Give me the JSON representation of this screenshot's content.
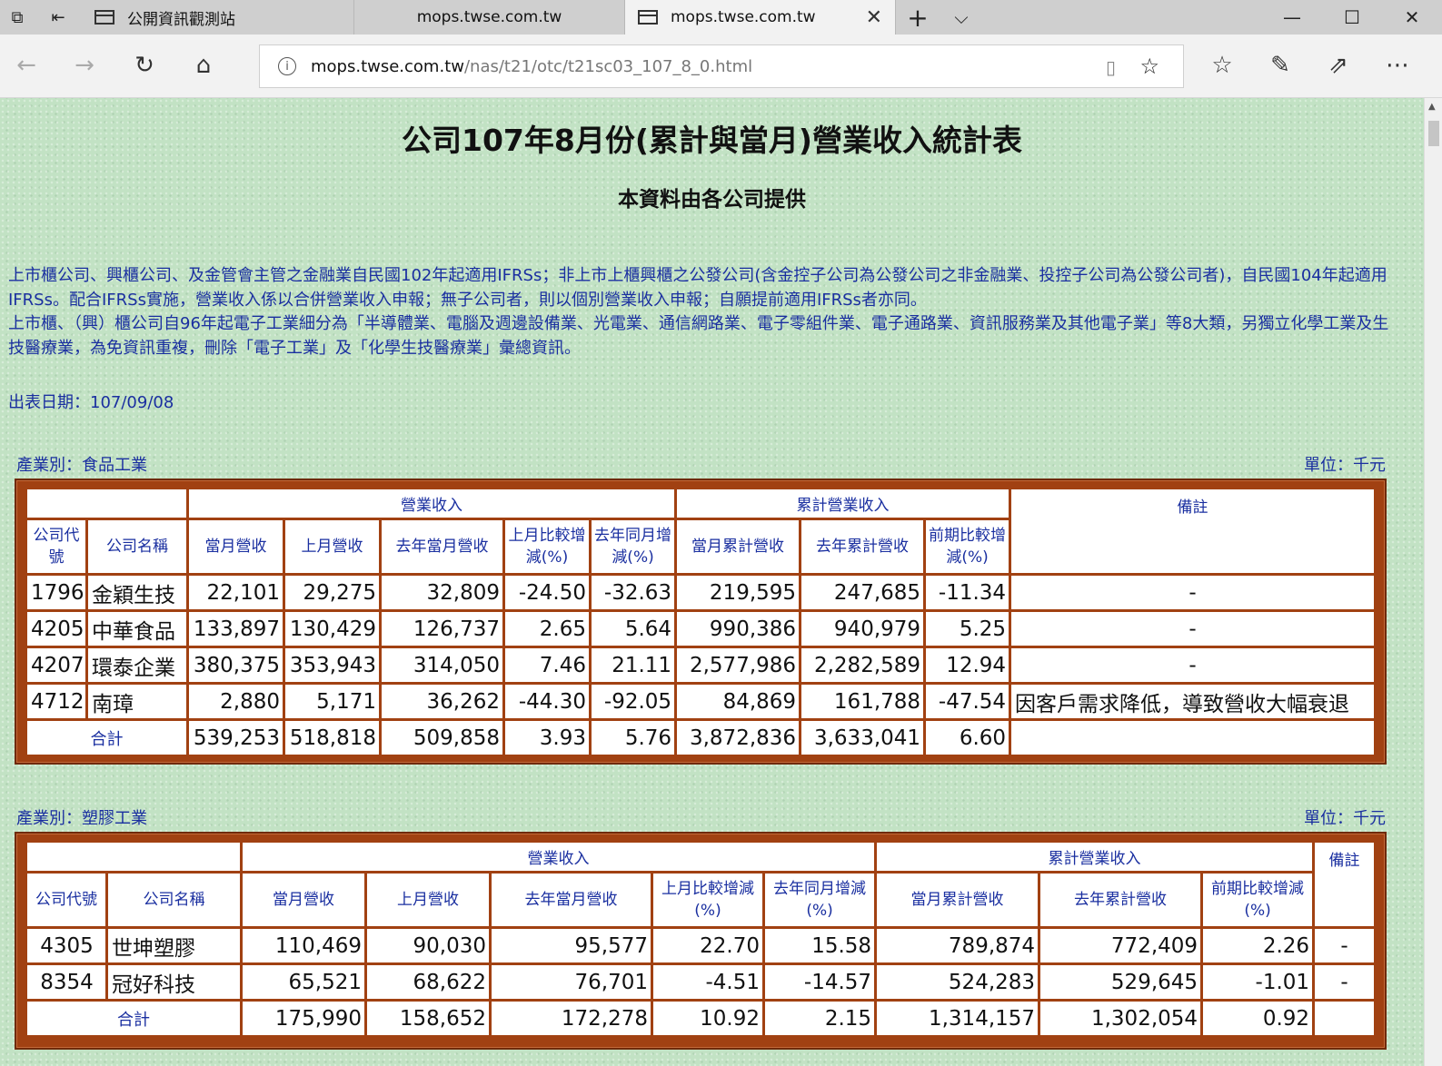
{
  "browser": {
    "tabs": [
      {
        "label": "公開資訊觀測站"
      },
      {
        "label": "mops.twse.com.tw"
      },
      {
        "label": "mops.twse.com.tw",
        "active": true
      }
    ],
    "url_host": "mops.twse.com.tw",
    "url_path": "/nas/t21/otc/t21sc03_107_8_0.html"
  },
  "page": {
    "title": "公司107年8月份(累計與當月)營業收入統計表",
    "subtitle": "本資料由各公司提供",
    "notes": [
      "上市櫃公司、興櫃公司、及金管會主管之金融業自民國102年起適用IFRSs；非上市上櫃興櫃之公發公司(含金控子公司為公發公司之非金融業、投控子公司為公發公司者)，自民國104年起適用IFRSs。配合IFRSs實施，營業收入係以合併營業收入申報；無子公司者，則以個別營業收入申報；自願提前適用IFRSs者亦同。",
      "上市櫃、（興）櫃公司自96年起電子工業細分為「半導體業、電腦及週邊設備業、光電業、通信網路業、電子零組件業、電子通路業、資訊服務業及其他電子業」等8大類，另獨立化學工業及生技醫療業，為免資訊重複，刪除「電子工業」及「化學生技醫療業」彙總資訊。"
    ],
    "issue_date": "出表日期：107/09/08"
  },
  "header_labels": {
    "revenue_group": "營業收入",
    "cumulative_group": "累計營業收入",
    "code": "公司代號",
    "name": "公司名稱",
    "curr_month": "當月營收",
    "last_month": "上月營收",
    "last_year_month": "去年當月營收",
    "mom_pct": "上月比較增減(%)",
    "yoy_pct": "去年同月增減(%)",
    "cum_curr": "當月累計營收",
    "cum_last_year": "去年累計營收",
    "cum_pct": "前期比較增減(%)",
    "remark": "備註",
    "total": "合計"
  },
  "industries": [
    {
      "label": "產業別：食品工業",
      "unit": "單位：千元",
      "rows": [
        {
          "code": "1796",
          "name": "金穎生技",
          "curr": "22,101",
          "last": "29,275",
          "ly": "32,809",
          "mom": "-24.50",
          "yoy": "-32.63",
          "cum": "219,595",
          "cum_ly": "247,685",
          "cum_pct": "-11.34",
          "remark": "-"
        },
        {
          "code": "4205",
          "name": "中華食品",
          "curr": "133,897",
          "last": "130,429",
          "ly": "126,737",
          "mom": "2.65",
          "yoy": "5.64",
          "cum": "990,386",
          "cum_ly": "940,979",
          "cum_pct": "5.25",
          "remark": "-"
        },
        {
          "code": "4207",
          "name": "環泰企業",
          "curr": "380,375",
          "last": "353,943",
          "ly": "314,050",
          "mom": "7.46",
          "yoy": "21.11",
          "cum": "2,577,986",
          "cum_ly": "2,282,589",
          "cum_pct": "12.94",
          "remark": "-"
        },
        {
          "code": "4712",
          "name": "南璋",
          "curr": "2,880",
          "last": "5,171",
          "ly": "36,262",
          "mom": "-44.30",
          "yoy": "-92.05",
          "cum": "84,869",
          "cum_ly": "161,788",
          "cum_pct": "-47.54",
          "remark": "因客戶需求降低，導致營收大幅衰退"
        }
      ],
      "total": {
        "curr": "539,253",
        "last": "518,818",
        "ly": "509,858",
        "mom": "3.93",
        "yoy": "5.76",
        "cum": "3,872,836",
        "cum_ly": "3,633,041",
        "cum_pct": "6.60",
        "remark": ""
      }
    },
    {
      "label": "產業別：塑膠工業",
      "unit": "單位：千元",
      "rows": [
        {
          "code": "4305",
          "name": "世坤塑膠",
          "curr": "110,469",
          "last": "90,030",
          "ly": "95,577",
          "mom": "22.70",
          "yoy": "15.58",
          "cum": "789,874",
          "cum_ly": "772,409",
          "cum_pct": "2.26",
          "remark": "-"
        },
        {
          "code": "8354",
          "name": "冠好科技",
          "curr": "65,521",
          "last": "68,622",
          "ly": "76,701",
          "mom": "-4.51",
          "yoy": "-14.57",
          "cum": "524,283",
          "cum_ly": "529,645",
          "cum_pct": "-1.01",
          "remark": "-"
        }
      ],
      "total": {
        "curr": "175,990",
        "last": "158,652",
        "ly": "172,278",
        "mom": "10.92",
        "yoy": "2.15",
        "cum": "1,314,157",
        "cum_ly": "1,302,054",
        "cum_pct": "0.92",
        "remark": ""
      }
    }
  ]
}
